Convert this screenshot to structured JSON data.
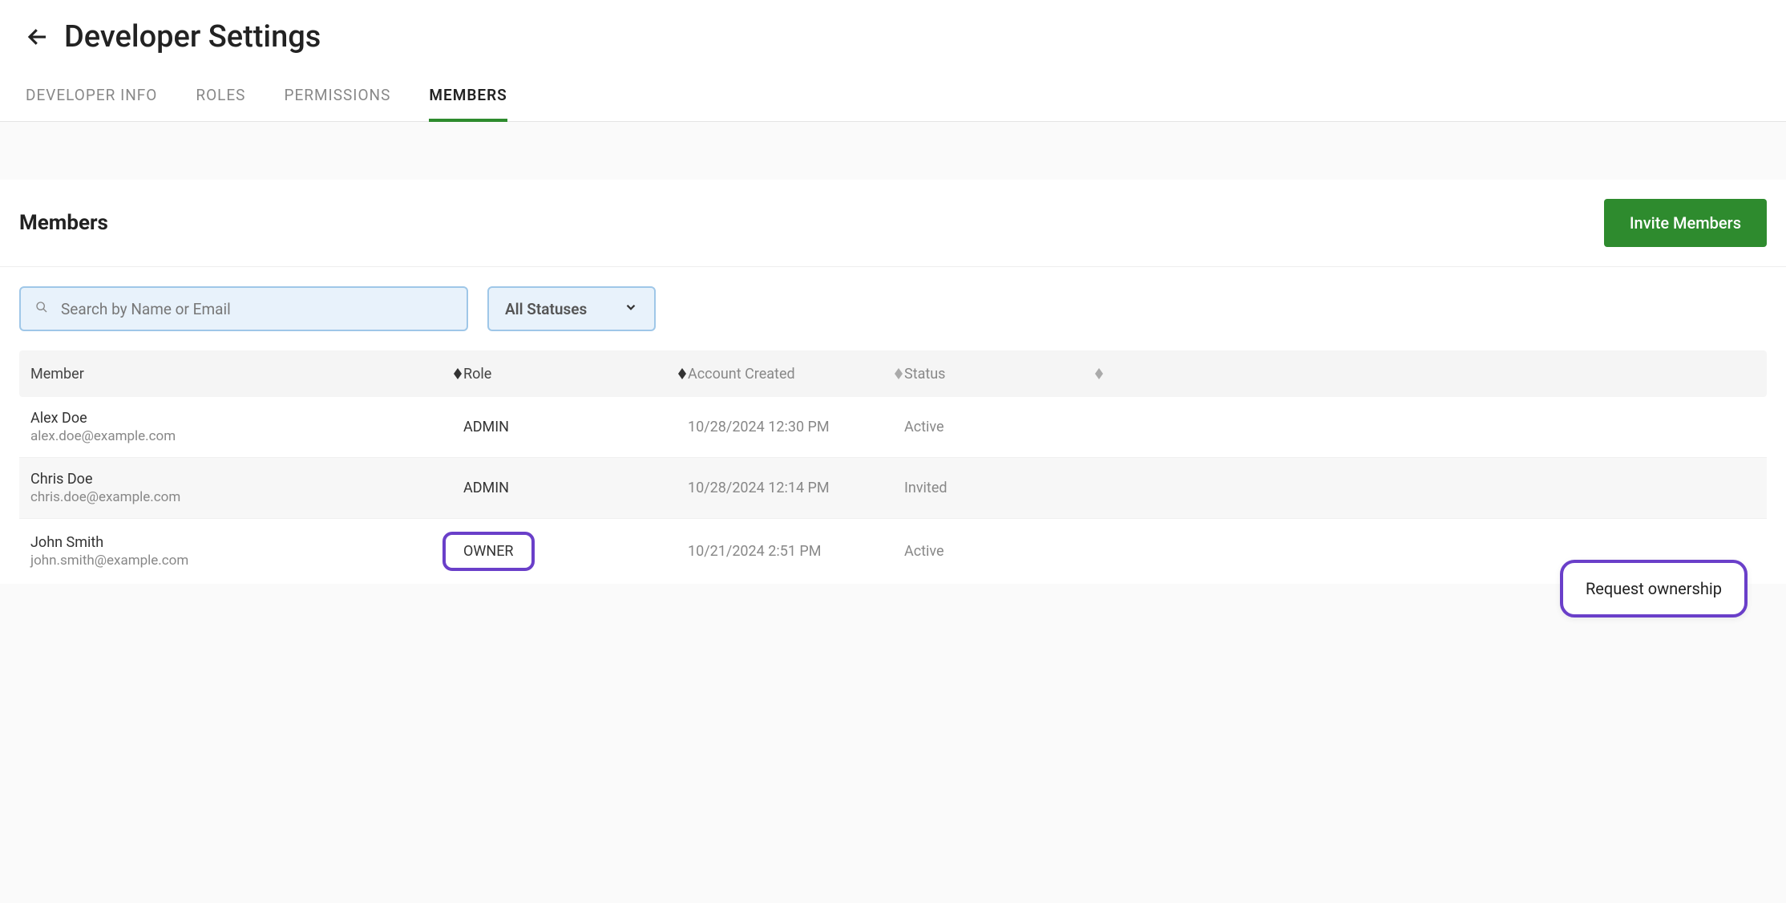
{
  "header": {
    "title": "Developer Settings"
  },
  "tabs": {
    "developer_info": "DEVELOPER INFO",
    "roles": "ROLES",
    "permissions": "PERMISSIONS",
    "members": "MEMBERS"
  },
  "section": {
    "title": "Members",
    "invite_button": "Invite Members"
  },
  "filters": {
    "search_placeholder": "Search by Name or Email",
    "status_label": "All Statuses"
  },
  "table": {
    "headers": {
      "member": "Member",
      "role": "Role",
      "created": "Account Created",
      "status": "Status"
    },
    "rows": [
      {
        "name": "Alex Doe",
        "email": "alex.doe@example.com",
        "role": "ADMIN",
        "created": "10/28/2024 12:30 PM",
        "status": "Active"
      },
      {
        "name": "Chris Doe",
        "email": "chris.doe@example.com",
        "role": "ADMIN",
        "created": "10/28/2024 12:14 PM",
        "status": "Invited"
      },
      {
        "name": "John Smith",
        "email": "john.smith@example.com",
        "role": "OWNER",
        "created": "10/21/2024 2:51 PM",
        "status": "Active"
      }
    ]
  },
  "popup": {
    "request_ownership": "Request ownership"
  },
  "colors": {
    "accent_green": "#2e8b2e",
    "highlight_purple": "#6a3fc9"
  }
}
